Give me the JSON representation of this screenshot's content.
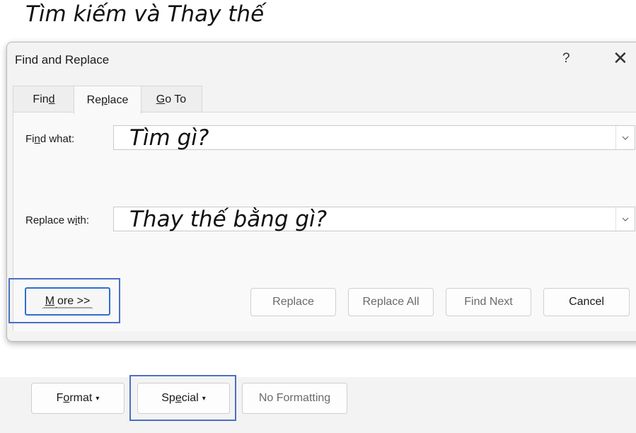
{
  "caption": "Tìm kiếm và Thay thế",
  "dialog": {
    "title": "Find and Replace",
    "help": "?",
    "close": "✕"
  },
  "tabs": [
    {
      "pre": "Fin",
      "key": "d",
      "post": ""
    },
    {
      "pre": "Re",
      "key": "p",
      "post": "lace"
    },
    {
      "pre": "",
      "key": "G",
      "post": "o To"
    }
  ],
  "find": {
    "label_pre": "Fi",
    "label_key": "n",
    "label_post": "d what:",
    "value": "Tìm gì?"
  },
  "replace": {
    "label_pre": "Replace w",
    "label_key": "i",
    "label_post": "th:",
    "value": "Thay thế bằng gì?"
  },
  "buttons": {
    "more_key": "M",
    "more_post": "ore >>",
    "replace": "Replace",
    "replace_all": "Replace All",
    "find_next": "Find Next",
    "cancel": "Cancel"
  },
  "bottom_buttons": {
    "format_pre": "F",
    "format_key": "o",
    "format_post": "rmat",
    "special_pre": "Sp",
    "special_key": "e",
    "special_post": "cial",
    "no_formatting": "No Formatting",
    "caret": "▾"
  },
  "colors": {
    "highlight": "#4a6fc4",
    "focus_border": "#2f6fce",
    "dialog_bg": "#f3f3f3"
  },
  "icons": {
    "dropdown": "chevron-down-icon",
    "close": "close-icon",
    "help": "help-icon"
  }
}
